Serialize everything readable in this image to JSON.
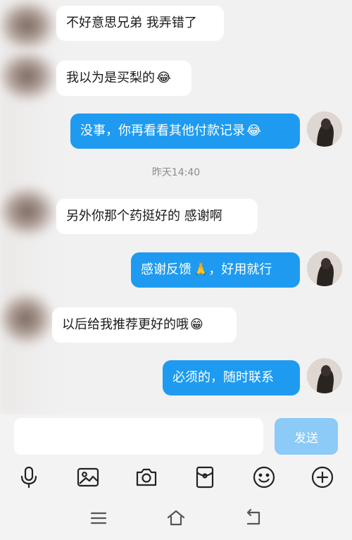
{
  "chat": {
    "messages": [
      {
        "side": "in",
        "text": "不好意思兄弟 我弄错了",
        "emoji": ""
      },
      {
        "side": "in",
        "text": "我以为是买梨的",
        "emoji": "😂"
      },
      {
        "side": "out",
        "text": "没事，你再看看其他付款记录",
        "emoji": "😂"
      },
      {
        "side": "in",
        "text": "另外你那个药挺好的  感谢啊",
        "emoji": ""
      },
      {
        "side": "out",
        "text": "感谢反馈",
        "emoji": "🙏",
        "text_after": "，好用就行"
      },
      {
        "side": "in",
        "text": "以后给我推荐更好的哦",
        "emoji": "😁"
      },
      {
        "side": "out",
        "text": "必须的，随时联系",
        "emoji": ""
      }
    ],
    "timestamp": "昨天14:40"
  },
  "input": {
    "value": "",
    "placeholder": "",
    "send_label": "发送"
  },
  "toolbar": {
    "icons": [
      "microphone-icon",
      "image-icon",
      "camera-icon",
      "red-packet-icon",
      "smiley-icon",
      "plus-icon"
    ]
  },
  "nav": {
    "icons": [
      "menu-icon",
      "home-icon",
      "back-icon"
    ]
  },
  "colors": {
    "outgoing_bubble": "#1e9bf0",
    "incoming_bubble": "#ffffff",
    "send_button": "#8ccaf7",
    "background": "#f1f1f1"
  }
}
